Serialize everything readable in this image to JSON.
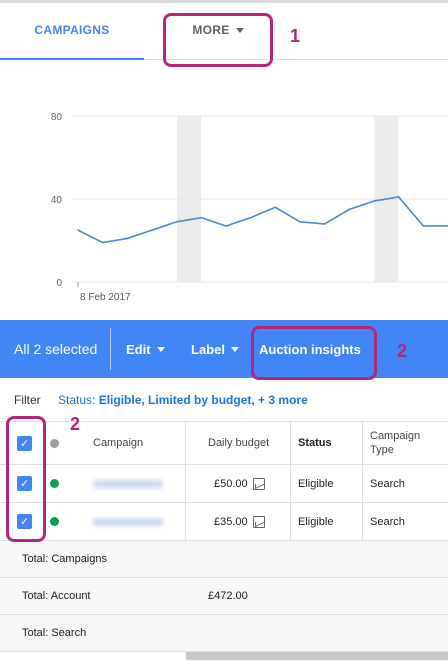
{
  "tabs": {
    "campaigns": "CAMPAIGNS",
    "more": "MORE"
  },
  "annotations": [
    "1",
    "2",
    "2"
  ],
  "chart_data": {
    "type": "line",
    "y_ticks": [
      "80",
      "40",
      "0"
    ],
    "ylim": [
      0,
      80
    ],
    "x_tick_label": "8 Feb 2017",
    "series": [
      {
        "values": [
          25,
          19,
          21,
          25,
          29,
          31,
          27,
          31,
          36,
          29,
          28,
          35,
          39,
          41,
          27,
          27
        ]
      }
    ],
    "shaded_columns": [
      4.5,
      12.5
    ],
    "grid": true,
    "colors": {
      "line": "#4a8ad4",
      "grid": "#e8e8e8",
      "shade": "#ececec"
    }
  },
  "actionbar": {
    "selected": "All 2 selected",
    "edit": "Edit",
    "label": "Label",
    "auction": "Auction insights"
  },
  "filter": {
    "label": "Filter",
    "status_prefix": "Status:",
    "status_values": "Eligible, Limited by budget, + 3 more"
  },
  "table": {
    "headers": {
      "campaign": "Campaign",
      "budget": "Daily budget",
      "status": "Status",
      "type": "Campaign Type"
    },
    "rows": [
      {
        "budget": "£50.00",
        "status": "Eligible",
        "type": "Search"
      },
      {
        "budget": "£35.00",
        "status": "Eligible",
        "type": "Search"
      }
    ],
    "totals": [
      {
        "label": "Total: Campaigns",
        "budget": ""
      },
      {
        "label": "Total: Account",
        "budget": "£472.00"
      },
      {
        "label": "Total: Search",
        "budget": ""
      }
    ]
  },
  "colors": {
    "accent": "#4285f4",
    "annotation": "#b5267a",
    "status_green": "#0f9d58",
    "status_grey": "#9e9e9e"
  }
}
